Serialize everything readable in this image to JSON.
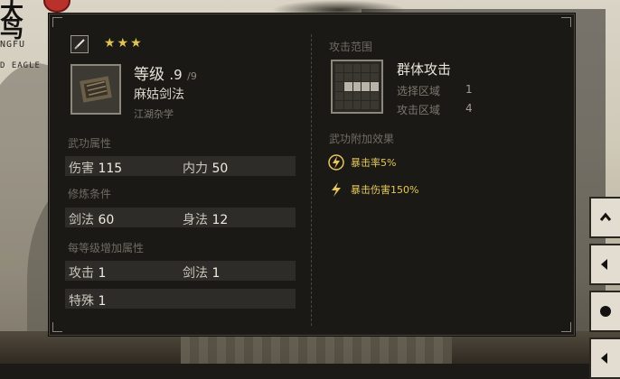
{
  "game_logo": {
    "char1": "大",
    "char2": "鸟",
    "subtitle1": "NGFU",
    "subtitle2": "D EAGLE"
  },
  "tooltip": {
    "type_icon": "sword-icon",
    "stars": "★★★",
    "level_label": "等级",
    "level_value": ".9",
    "level_max": "/9",
    "skill_name": "麻姑剑法",
    "skill_category": "江湖杂学",
    "attributes_title": "武功属性",
    "attributes": [
      {
        "label": "伤害",
        "value": "115"
      },
      {
        "label": "内力",
        "value": "50"
      }
    ],
    "requirements_title": "修炼条件",
    "requirements": [
      {
        "label": "剑法",
        "value": "60"
      },
      {
        "label": "身法",
        "value": "12"
      }
    ],
    "per_level_title": "每等级增加属性",
    "per_level": [
      {
        "label": "攻击",
        "value": "1"
      },
      {
        "label": "剑法",
        "value": "1"
      },
      {
        "label": "特殊",
        "value": "1"
      }
    ],
    "range_title": "攻击范围",
    "range_name": "群体攻击",
    "select_label": "选择区域",
    "select_value": "1",
    "attack_label": "攻击区域",
    "attack_value": "4",
    "effects_title": "武功附加效果",
    "effects": [
      {
        "text": "暴击率5%",
        "icon": "lightning-icon"
      },
      {
        "text": "暴击伤害150%",
        "icon": "lightning-icon"
      }
    ]
  },
  "colors": {
    "panel_bg": "#1a1916",
    "gold": "#e2c454",
    "effect_text": "#e6c95a"
  }
}
